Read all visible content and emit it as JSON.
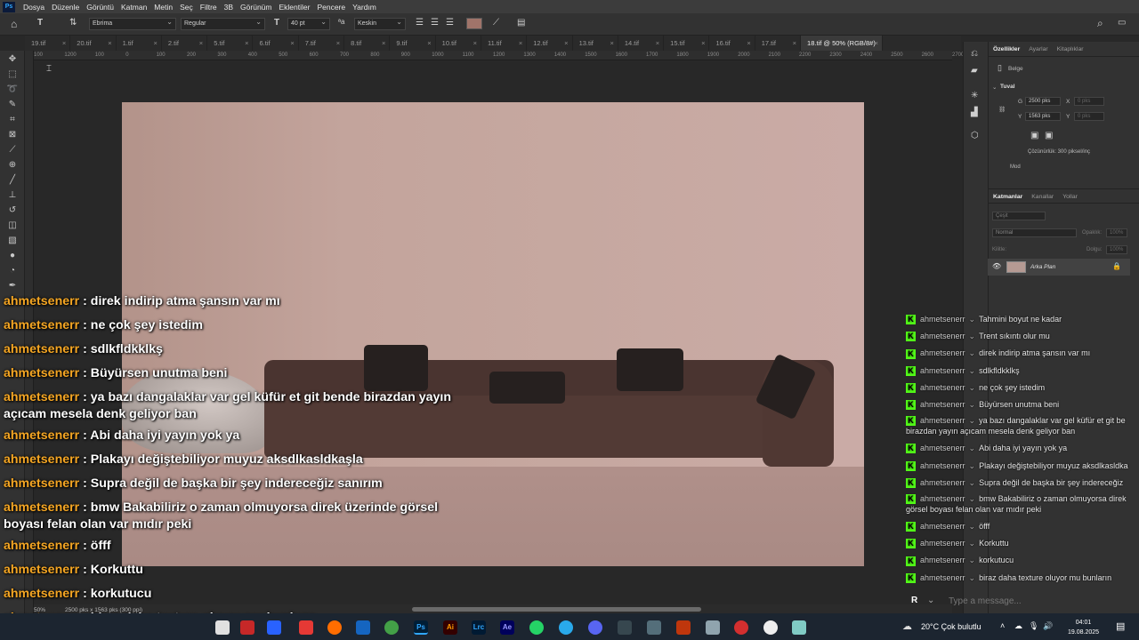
{
  "menu": [
    "Dosya",
    "Düzenle",
    "Görüntü",
    "Katman",
    "Metin",
    "Seç",
    "Filtre",
    "3B",
    "Görünüm",
    "Eklentiler",
    "Pencere",
    "Yardım"
  ],
  "options": {
    "font_family": "Ebrima",
    "font_style": "Regular",
    "font_size": "40 pt",
    "antialias": "Keskin"
  },
  "tabs": [
    "19.tif",
    "20.tif",
    "1.tif",
    "2.tif",
    "5.tif",
    "6.tif",
    "7.tif",
    "8.tif",
    "9.tif",
    "10.tif",
    "11.tif",
    "12.tif",
    "13.tif",
    "14.tif",
    "15.tif",
    "16.tif",
    "17.tif",
    "18.tif @ 50% (RGB/8#)"
  ],
  "ruler_ticks": [
    "100",
    "1200",
    "100",
    "0",
    "100",
    "200",
    "300",
    "400",
    "500",
    "600",
    "700",
    "800",
    "900",
    "1000",
    "1100",
    "1200",
    "1300",
    "1400",
    "1500",
    "1600",
    "1700",
    "1800",
    "1900",
    "2000",
    "2100",
    "2200",
    "2300",
    "2400",
    "2500",
    "2600",
    "2700"
  ],
  "status": {
    "zoom": "50%",
    "size": "2500 pks x 1563 pks (300 ppi)"
  },
  "properties": {
    "tabs": [
      "Özellikler",
      "Ayarlar",
      "Kitaplıklar"
    ],
    "doc_label": "Belge",
    "canvas_heading": "Tuval",
    "w_label": "G",
    "w_value": "2500 pks",
    "h_label": "Y",
    "h_value": "1563 pks",
    "x_label": "X",
    "x_value": "0 pks",
    "y_label": "Y",
    "y_value": "0 pks",
    "resolution": "Çözünürlük: 300 piksel/inç",
    "mode": "Mod"
  },
  "layers": {
    "tabs": [
      "Katmanlar",
      "Kanallar",
      "Yollar"
    ],
    "filter_placeholder": "Çeşit",
    "blend": "Normal",
    "opacity_label": "Opaklık:",
    "opacity_value": "100%",
    "lock_label": "Kilitle:",
    "fill_label": "Dolgu:",
    "fill_value": "100%",
    "layer_name": "Arka Plan"
  },
  "chat_left": [
    {
      "user": "ahmetsenerr",
      "text": "direk indirip atma şansın var mı"
    },
    {
      "user": "ahmetsenerr",
      "text": "ne çok şey istedim"
    },
    {
      "user": "ahmetsenerr",
      "text": "sdlkfldkklkş"
    },
    {
      "user": "ahmetsenerr",
      "text": "Büyürsen unutma beni"
    },
    {
      "user": "ahmetsenerr",
      "text": "ya bazı dangalaklar var gel küfür et git bende birazdan yayın",
      "cont": "açıcam mesela denk geliyor ban"
    },
    {
      "user": "ahmetsenerr",
      "text": "Abi daha iyi yayın yok ya"
    },
    {
      "user": "ahmetsenerr",
      "text": "Plakayı değiştebiliyor muyuz aksdlkasldkaşla"
    },
    {
      "user": "ahmetsenerr",
      "text": "Supra değil de başka bir şey indereceğiz sanırım"
    },
    {
      "user": "ahmetsenerr",
      "text": "bmw Bakabiliriz o zaman olmuyorsa direk üzerinde görsel",
      "cont": "boyası felan olan var mıdır peki"
    },
    {
      "user": "ahmetsenerr",
      "text": "öfff"
    },
    {
      "user": "ahmetsenerr",
      "text": "Korkuttu"
    },
    {
      "user": "ahmetsenerr",
      "text": "korkutucu"
    },
    {
      "user": "ahmetsenerr",
      "text": "biraz daha texture oluyor mu bunların"
    }
  ],
  "chat_right": [
    {
      "user": "ahmetsenerr",
      "text": "Tahmini boyut ne kadar"
    },
    {
      "user": "ahmetsenerr",
      "text": "Trent sıkıntı olur mu"
    },
    {
      "user": "ahmetsenerr",
      "text": "direk indirip atma şansın var mı"
    },
    {
      "user": "ahmetsenerr",
      "text": "sdlkfldkklkş"
    },
    {
      "user": "ahmetsenerr",
      "text": "ne çok şey istedim"
    },
    {
      "user": "ahmetsenerr",
      "text": "Büyürsen unutma beni"
    },
    {
      "user": "ahmetsenerr",
      "text": "ya bazı dangalaklar var gel küfür et git be",
      "cont": "birazdan yayın açıcam mesela denk geliyor ban"
    },
    {
      "user": "ahmetsenerr",
      "text": "Abi daha iyi yayın yok ya"
    },
    {
      "user": "ahmetsenerr",
      "text": "Plakayı değiştebiliyor muyuz aksdlkasldka"
    },
    {
      "user": "ahmetsenerr",
      "text": "Supra değil de başka bir şey indereceğiz"
    },
    {
      "user": "ahmetsenerr",
      "text": "bmw Bakabiliriz o zaman olmuyorsa direk",
      "cont": "görsel boyası felan olan var mıdır peki"
    },
    {
      "user": "ahmetsenerr",
      "text": "öfff"
    },
    {
      "user": "ahmetsenerr",
      "text": "Korkuttu"
    },
    {
      "user": "ahmetsenerr",
      "text": "korkutucu"
    },
    {
      "user": "ahmetsenerr",
      "text": "biraz daha texture oluyor mu bunların"
    }
  ],
  "chat_input_placeholder": "Type a message...",
  "chat_avatar": "R",
  "taskbar": {
    "weather": "20°C  Çok bulutlu",
    "time": "04:01",
    "date": "19.08.2025"
  },
  "colors": {
    "accent": "#31a8ff",
    "chat_user": "#f5a623",
    "kick": "#53fc18",
    "swatch": "#a0746a"
  }
}
